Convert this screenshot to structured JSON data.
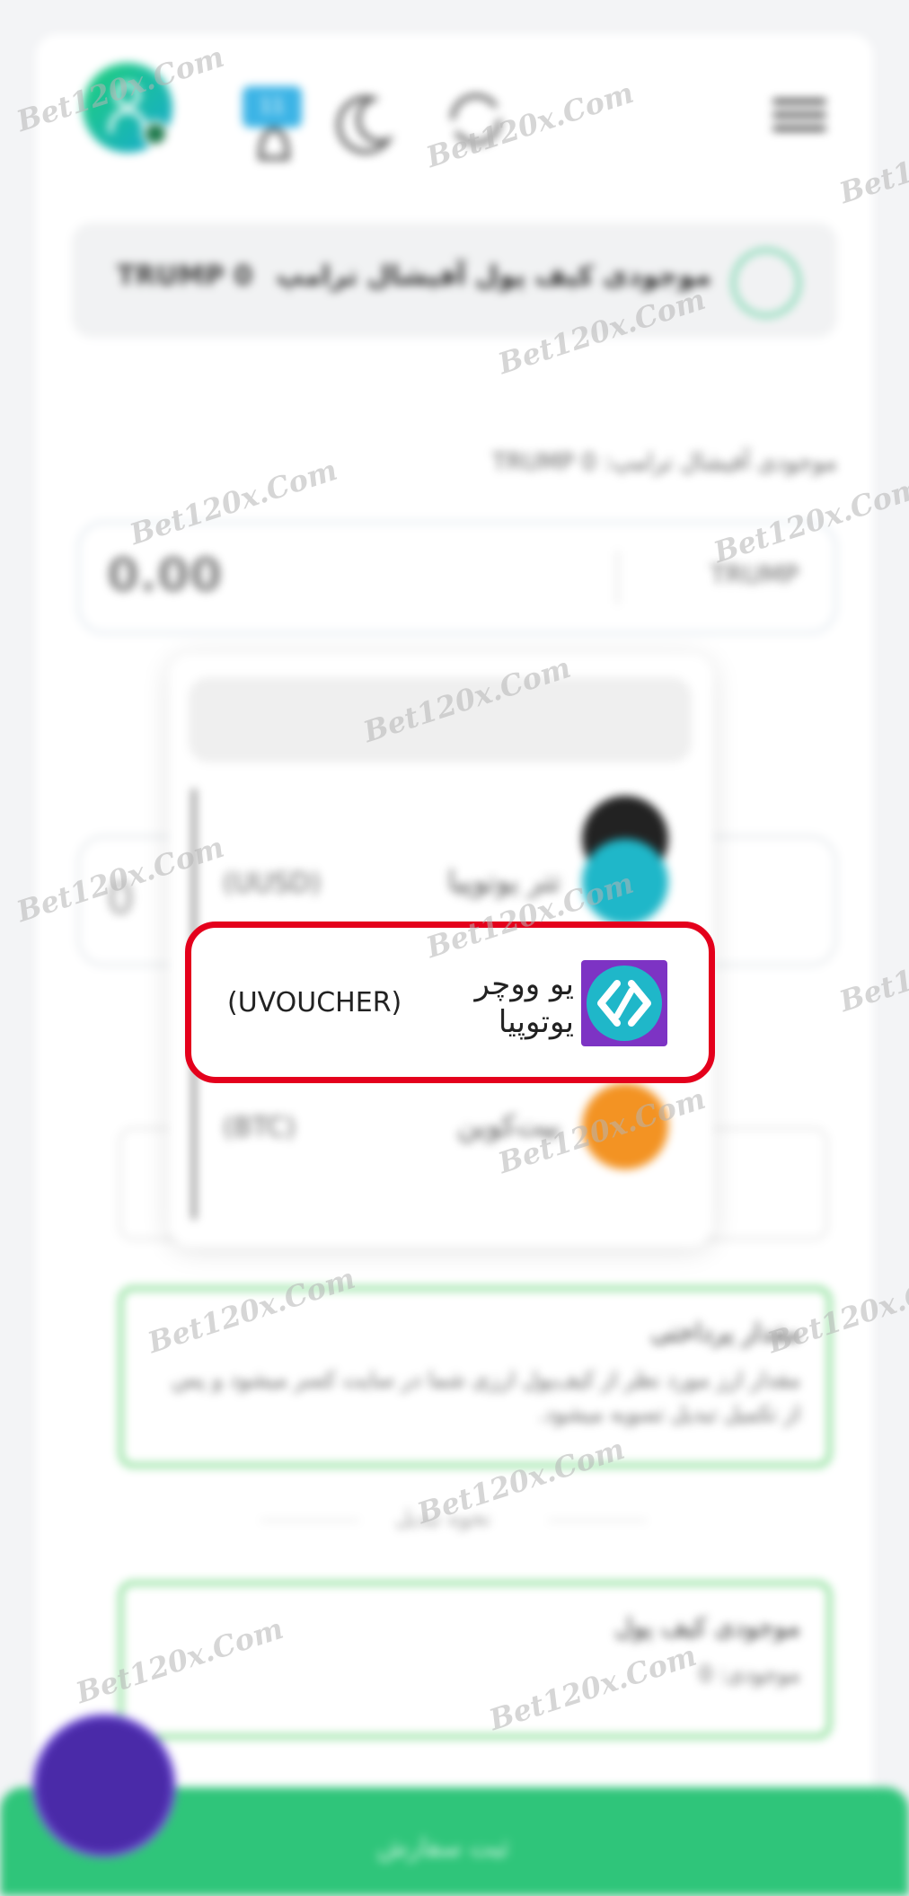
{
  "header": {
    "notification_count": "11"
  },
  "wallet": {
    "title": "موجودی کیف پول آفیشال ترامپ",
    "amount": "TRUMP  0"
  },
  "balance_label": "موجودی آفیشال ترامپ: TRUMP 0",
  "amount_input": {
    "value": "0.00",
    "token": "TRUMP"
  },
  "second_input": {
    "value": "0"
  },
  "dropdown": {
    "items": [
      {
        "name": "تتر یوتوپیا",
        "code": "(UUSD)"
      },
      {
        "name": "یو ووچر یوتوپیا",
        "code": "(UVOUCHER)"
      },
      {
        "name": "بیت‌کوین",
        "code": "(BTC)"
      }
    ],
    "highlighted": {
      "name_line1": "یو ووچر",
      "name_line2": "یوتوپیا",
      "code": "(UVOUCHER)"
    }
  },
  "cards": {
    "card_a_title": "مقدار پرداختی",
    "card_a_text": "مقدار ارز مورد نظر از کیف‌پول ارزی شما در سایت کسر میشود و پس از تکمیل تبدیل تسویه میشود.",
    "card_b_title": "موجودی کیف پول",
    "card_b_text": "موجودی: 0",
    "separator_text": "نحوه تبدیل"
  },
  "submit": {
    "label": "ثبت سفارش"
  },
  "watermark": "Bet120x.Com",
  "colors": {
    "accent_green": "#2fc57a",
    "highlight_red": "#e4001c",
    "uvoucher_purple": "#7d33c4",
    "uvoucher_teal": "#1fb7c9"
  }
}
